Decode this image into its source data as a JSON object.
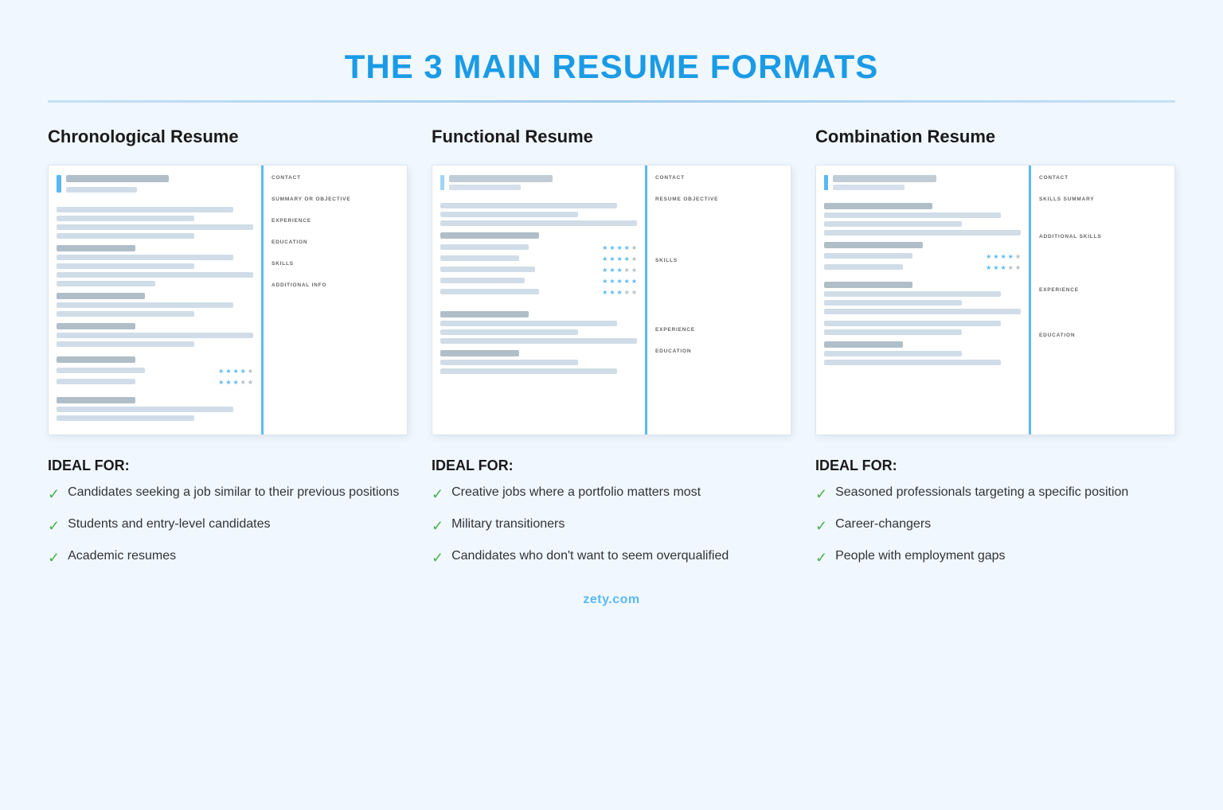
{
  "page": {
    "title": "THE 3 MAIN RESUME FORMATS",
    "footer": "zety.com"
  },
  "columns": [
    {
      "id": "chronological",
      "title": "Chronological Resume",
      "sections": [
        "CONTACT",
        "SUMMARY OR OBJECTIVE",
        "EXPERIENCE",
        "EDUCATION",
        "SKILLS",
        "ADDITIONAL INFO"
      ],
      "ideal_title": "IDEAL FOR:",
      "ideal_items": [
        "Candidates seeking a job similar to their previous positions",
        "Students and entry-level candidates",
        "Academic resumes"
      ]
    },
    {
      "id": "functional",
      "title": "Functional Resume",
      "sections": [
        "CONTACT",
        "RESUME OBJECTIVE",
        "SKILLS",
        "EXPERIENCE",
        "EDUCATION"
      ],
      "ideal_title": "IDEAL FOR:",
      "ideal_items": [
        "Creative jobs where a portfolio matters most",
        "Military transitioners",
        "Candidates who don't want to seem overqualified"
      ]
    },
    {
      "id": "combination",
      "title": "Combination Resume",
      "sections": [
        "CONTACT",
        "SKILLS SUMMARY",
        "ADDITIONAL SKILLS",
        "EXPERIENCE",
        "EDUCATION"
      ],
      "ideal_title": "IDEAL FOR:",
      "ideal_items": [
        "Seasoned professionals targeting a specific position",
        "Career-changers",
        "People with employment gaps"
      ]
    }
  ],
  "icons": {
    "check": "✓"
  }
}
